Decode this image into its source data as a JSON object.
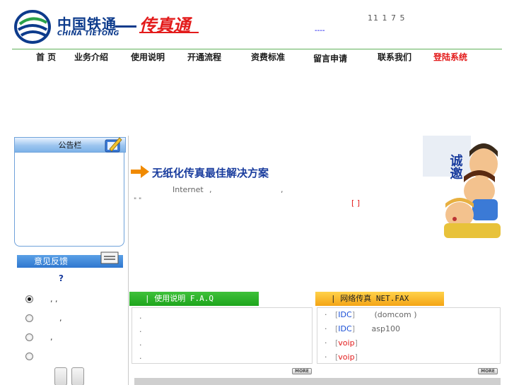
{
  "header": {
    "logo_cn": "中国铁通",
    "logo_en": "CHINA TIETONG",
    "logo_fax": "传真通",
    "hotline": "11 1 7 5",
    "hotline_sub": "----"
  },
  "nav": {
    "items": [
      {
        "label": "首  页"
      },
      {
        "label": "业务介绍"
      },
      {
        "label": "使用说明"
      },
      {
        "label": "开通流程"
      },
      {
        "label": "资费标准"
      },
      {
        "label": "留言申请"
      },
      {
        "label": "联系我们"
      },
      {
        "label": "登陆系统"
      }
    ]
  },
  "sidebar": {
    "notice_title": "公告栏",
    "feedback_title": "意见反馈",
    "feedback_question": "?",
    "options": [
      {
        "label": ", ,",
        "checked": true
      },
      {
        "label": ",",
        "checked": false
      },
      {
        "label": ",",
        "checked": false
      },
      {
        "label": "",
        "checked": false
      }
    ]
  },
  "promo": {
    "title": "无纸化传真最佳解决方案",
    "line1": "Internet",
    "comma1": ",",
    "comma2": ",",
    "quote": "\" \"",
    "link": "[ ]"
  },
  "sections": {
    "usage": {
      "title": "| 使用说明   F.A.Q",
      "items": [
        ".",
        ".",
        ".",
        "."
      ],
      "more": "MORE"
    },
    "fax": {
      "title": "| 网络传真   NET.FAX",
      "items": [
        {
          "bullet": "·",
          "tag": "IDC",
          "text": "(domcom )"
        },
        {
          "bullet": "·",
          "tag": "IDC",
          "text": "asp100"
        },
        {
          "bullet": "·",
          "tag": "voip",
          "text": ""
        },
        {
          "bullet": "·",
          "tag": "voip",
          "text": ""
        }
      ],
      "more": "MORE"
    }
  },
  "invite": {
    "text": "诚邀"
  },
  "colors": {
    "brand_blue": "#0d3b8c",
    "brand_red": "#e31b1b",
    "nav_green": "#5fb15a",
    "usage_green": "#1ea51c",
    "fax_orange": "#f4a415",
    "sidebar_blue": "#2f77cf"
  }
}
